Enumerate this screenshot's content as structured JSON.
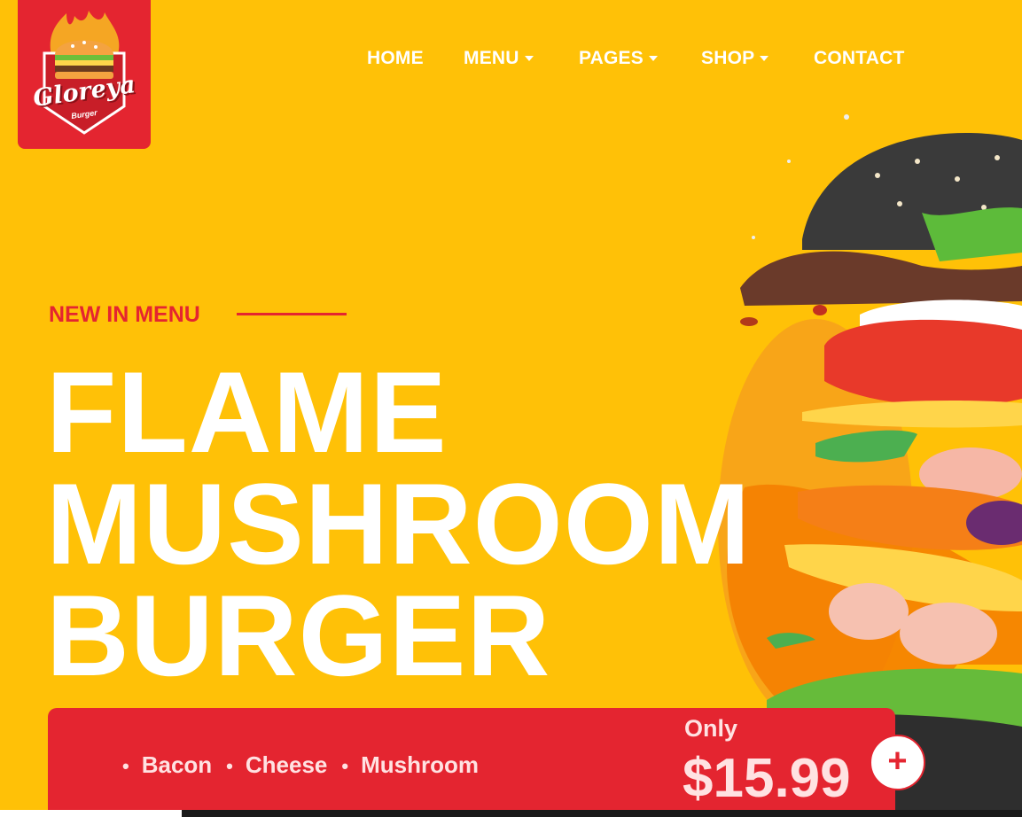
{
  "brand": {
    "name": "Gloreya",
    "tagline": "Burger"
  },
  "nav": {
    "items": [
      {
        "label": "HOME",
        "dropdown": false
      },
      {
        "label": "MENU",
        "dropdown": true
      },
      {
        "label": "PAGES",
        "dropdown": true
      },
      {
        "label": "SHOP",
        "dropdown": true
      },
      {
        "label": "CONTACT",
        "dropdown": false
      }
    ]
  },
  "hero": {
    "eyebrow": "NEW IN MENU",
    "title_lines": [
      "FLAME",
      "MUSHROOM",
      "BURGER"
    ],
    "ingredients": [
      "Bacon",
      "Cheese",
      "Mushroom"
    ],
    "price_prefix": "Only",
    "price": "$15.99",
    "add_symbol": "+"
  },
  "colors": {
    "background": "#FFC107",
    "accent": "#E42530",
    "text_light": "#FFFFFF"
  },
  "icons": {
    "dropdown": "caret-down-icon",
    "add": "plus-icon"
  }
}
